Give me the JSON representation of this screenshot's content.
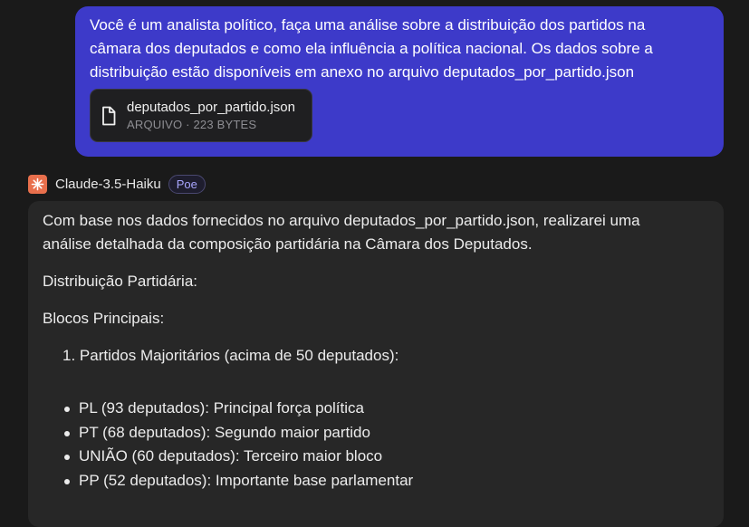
{
  "user_message": {
    "text": "Você é um analista político, faça uma análise sobre a distribuição dos partidos na câmara dos deputados e como ela influência a política nacional. Os dados sobre a distribuição estão disponíveis em anexo no arquivo deputados_por_partido.json",
    "line1": "Você é um analista político, faça uma análise sobre a distribuição dos partidos na",
    "line2": "câmara dos deputados e como ela influência a política nacional. Os dados sobre a",
    "line3": "distribuição estão disponíveis em anexo no arquivo deputados_por_partido.json",
    "attachment": {
      "name": "deputados_por_partido.json",
      "info": "ARQUIVO · 223 BYTES",
      "icon": "file-icon"
    }
  },
  "bot": {
    "name": "Claude-3.5-Haiku",
    "badge": "Poe",
    "avatar_icon": "claude-starburst-icon",
    "avatar_color": "#e86f4c"
  },
  "response": {
    "intro_line1": "Com base nos dados fornecidos no arquivo deputados_por_partido.json, realizarei uma",
    "intro_line2": "análise detalhada da composição partidária na Câmara dos Deputados.",
    "heading1": "Distribuição Partidária:",
    "heading2": "Blocos Principais:",
    "ordered_items": [
      "1. Partidos Majoritários (acima de 50 deputados):"
    ],
    "bullets": [
      "PL (93 deputados): Principal força política",
      "PT (68 deputados): Segundo maior partido",
      "UNIÃO (60 deputados): Terceiro maior bloco",
      "PP (52 deputados): Importante base parlamentar"
    ]
  },
  "colors": {
    "background": "#1a1a1a",
    "user_bubble": "#3d3ac9",
    "bot_bubble": "#272727",
    "badge_text": "#a9a6ff"
  }
}
